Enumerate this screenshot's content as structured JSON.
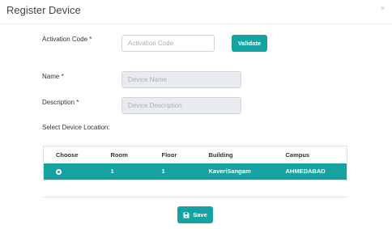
{
  "dialog": {
    "title": "Register Device",
    "close_label": "×"
  },
  "form": {
    "activation_code": {
      "label": "Activation Code *",
      "placeholder": "Activation Code",
      "value": ""
    },
    "validate_label": "Validate",
    "name": {
      "label": "Name *",
      "placeholder": "Device Name",
      "value": ""
    },
    "description": {
      "label": "Description *",
      "placeholder": "Device Description",
      "value": ""
    },
    "location_label": "Select Device Location:"
  },
  "table": {
    "columns": [
      "Choose",
      "Room",
      "Floor",
      "Building",
      "Campus"
    ],
    "rows": [
      {
        "selected": true,
        "room": "1",
        "floor": "1",
        "building": "KaveriSangam",
        "campus": "AHMEDABAD"
      }
    ]
  },
  "footer": {
    "save_label": "Save",
    "save_icon": "floppy-disk-icon"
  },
  "colors": {
    "accent": "#17a2a2",
    "disabled_input": "#e9ecef"
  }
}
